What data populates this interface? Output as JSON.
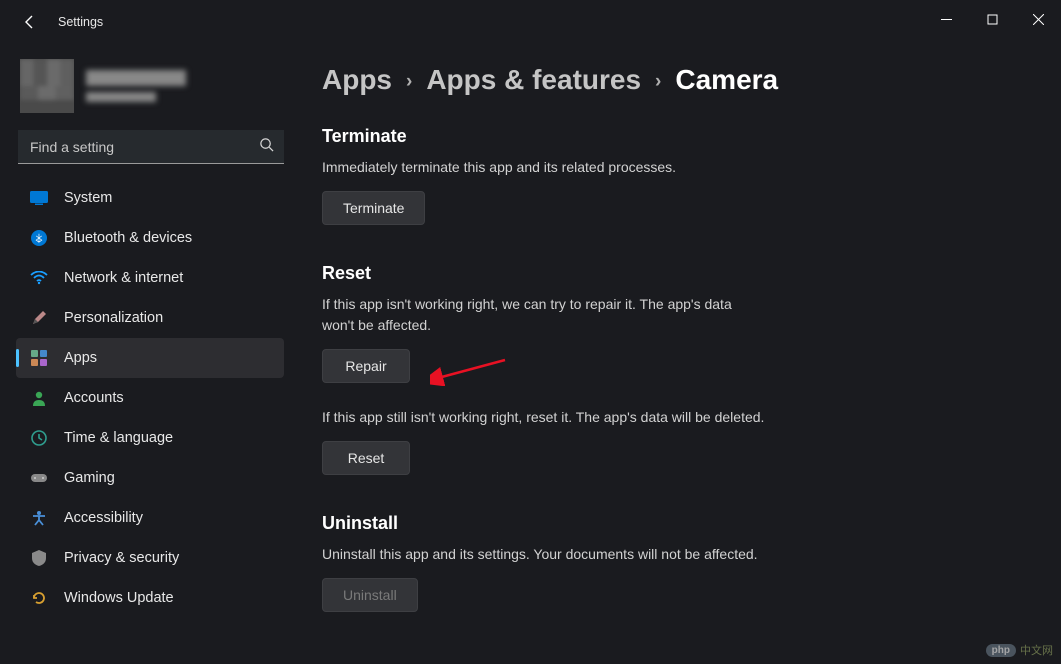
{
  "window": {
    "title": "Settings"
  },
  "sidebar": {
    "search_placeholder": "Find a setting",
    "items": [
      {
        "label": "System"
      },
      {
        "label": "Bluetooth & devices"
      },
      {
        "label": "Network & internet"
      },
      {
        "label": "Personalization"
      },
      {
        "label": "Apps"
      },
      {
        "label": "Accounts"
      },
      {
        "label": "Time & language"
      },
      {
        "label": "Gaming"
      },
      {
        "label": "Accessibility"
      },
      {
        "label": "Privacy & security"
      },
      {
        "label": "Windows Update"
      }
    ]
  },
  "breadcrumb": {
    "root": "Apps",
    "mid": "Apps & features",
    "current": "Camera"
  },
  "sections": {
    "terminate": {
      "title": "Terminate",
      "desc": "Immediately terminate this app and its related processes.",
      "button": "Terminate"
    },
    "reset": {
      "title": "Reset",
      "desc1": "If this app isn't working right, we can try to repair it. The app's data won't be affected.",
      "repair_button": "Repair",
      "desc2": "If this app still isn't working right, reset it. The app's data will be deleted.",
      "reset_button": "Reset"
    },
    "uninstall": {
      "title": "Uninstall",
      "desc": "Uninstall this app and its settings. Your documents will not be affected.",
      "button": "Uninstall"
    }
  },
  "watermark": {
    "brand": "php",
    "text": "中文网"
  }
}
